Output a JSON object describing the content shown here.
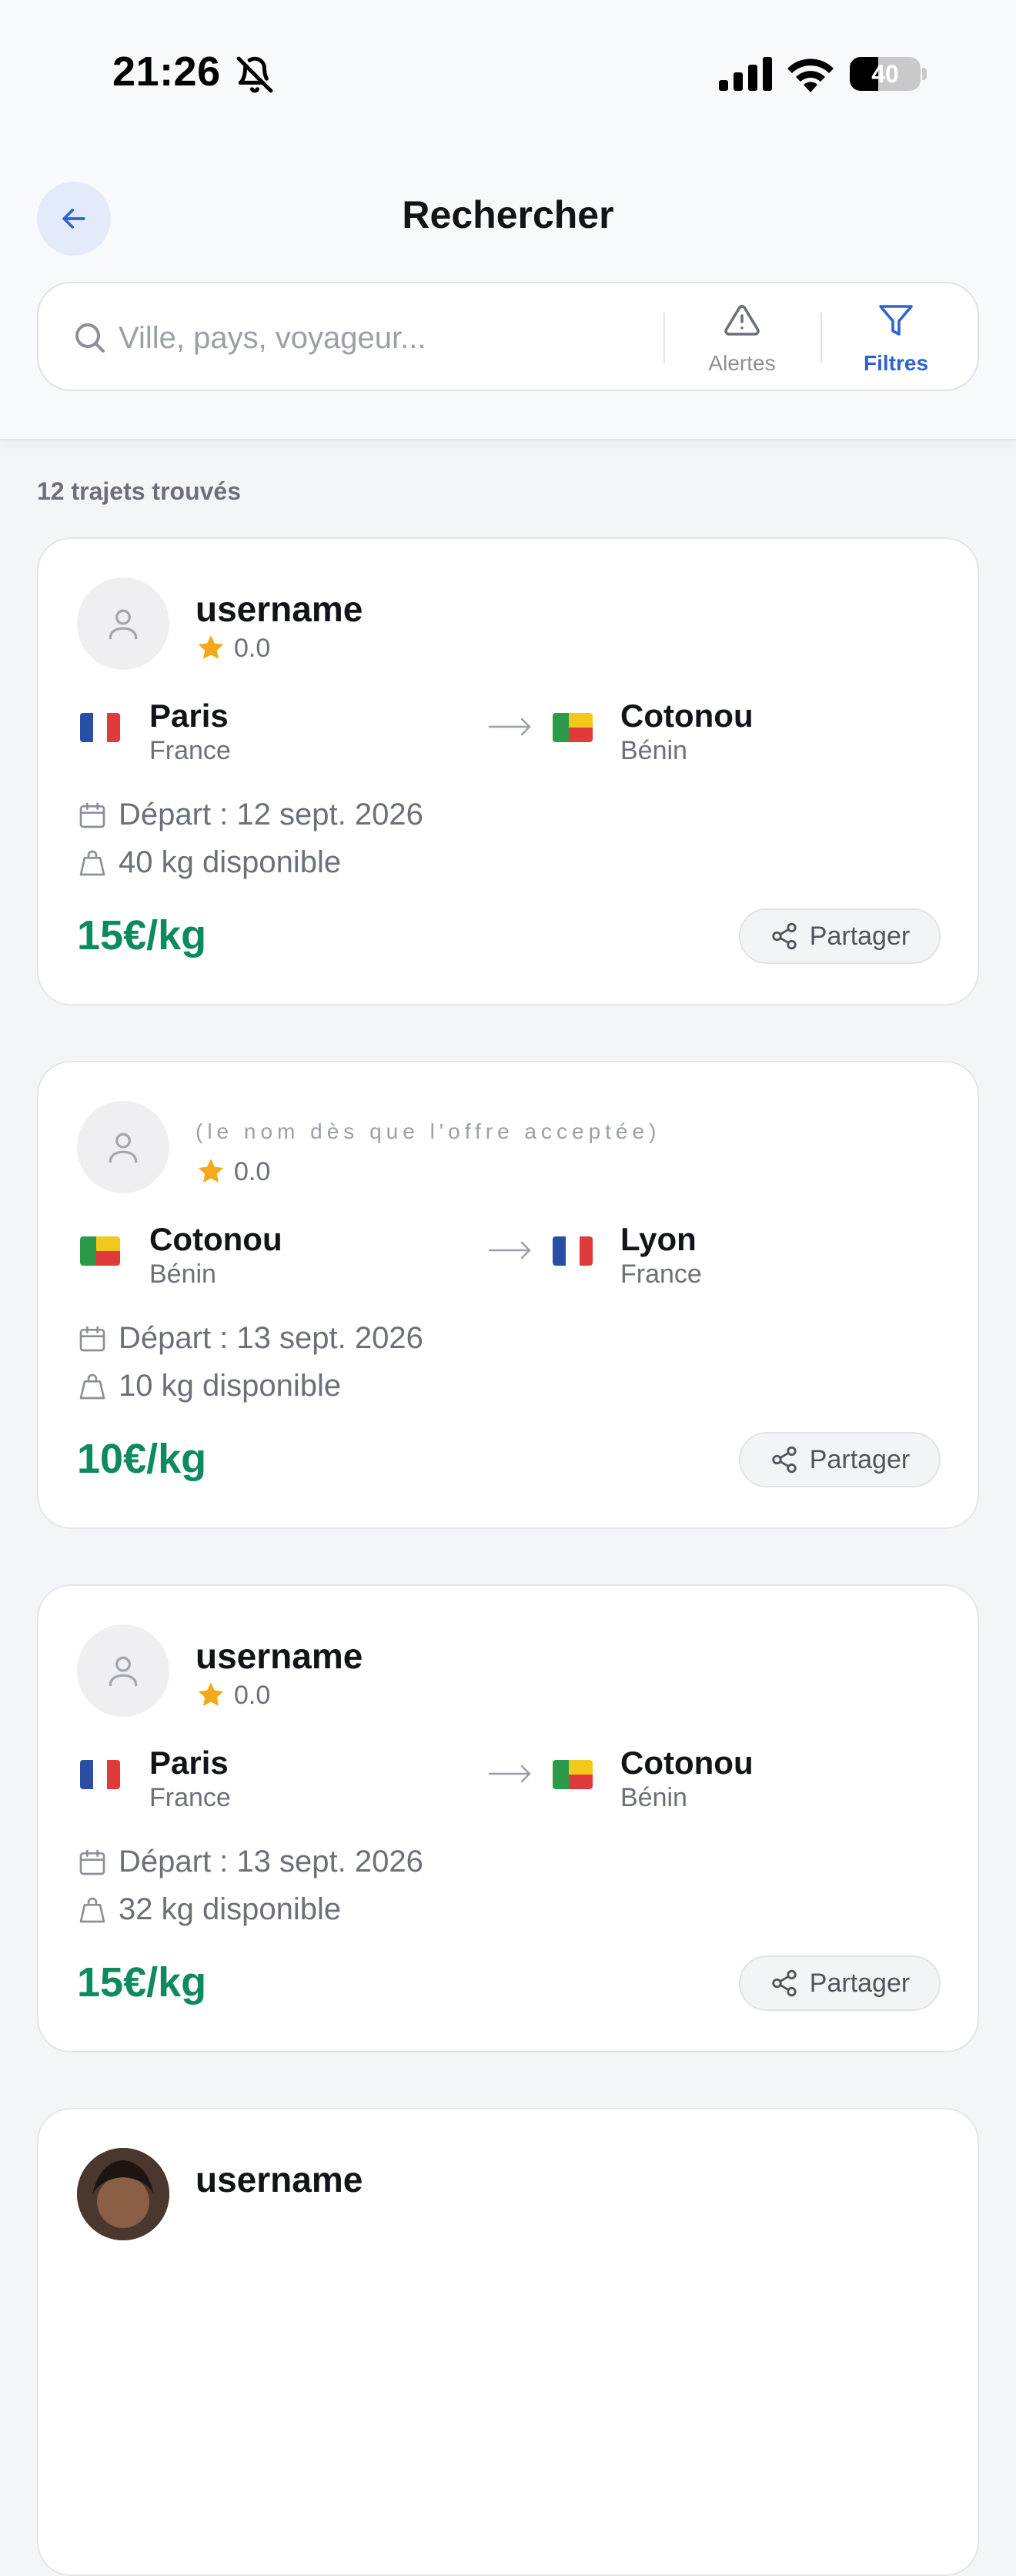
{
  "status_bar": {
    "time": "21:26",
    "battery": "40",
    "battery_level": 0.4
  },
  "header": {
    "title": "Rechercher"
  },
  "search": {
    "placeholder": "Ville, pays, voyageur...",
    "alerts_label": "Alertes",
    "filters_label": "Filtres"
  },
  "results": {
    "count_text": "12 trajets trouvés"
  },
  "cards": [
    {
      "username": "username",
      "rating": "0.0",
      "from_city": "Paris",
      "from_country": "France",
      "to_city": "Cotonou",
      "to_country": "Bénin",
      "departure": "Départ : 12 sept. 2026",
      "capacity": "40 kg disponible",
      "price": "15€/kg",
      "share_label": "Partager"
    },
    {
      "username": "(le nom dès que l'offre acceptée)",
      "rating": "0.0",
      "from_city": "Cotonou",
      "from_country": "Bénin",
      "to_city": "Lyon",
      "to_country": "France",
      "departure": "Départ : 13 sept. 2026",
      "capacity": "10 kg disponible",
      "price": "10€/kg",
      "share_label": "Partager"
    },
    {
      "username": "username",
      "rating": "0.0",
      "from_city": "Paris",
      "from_country": "France",
      "to_city": "Cotonou",
      "to_country": "Bénin",
      "departure": "Départ : 13 sept. 2026",
      "capacity": "32 kg disponible",
      "price": "15€/kg",
      "share_label": "Partager"
    },
    {
      "username": "username"
    }
  ],
  "colors": {
    "accent_blue": "#2f63d3",
    "price_green": "#0e8a5f",
    "star": "#f2a91b"
  }
}
